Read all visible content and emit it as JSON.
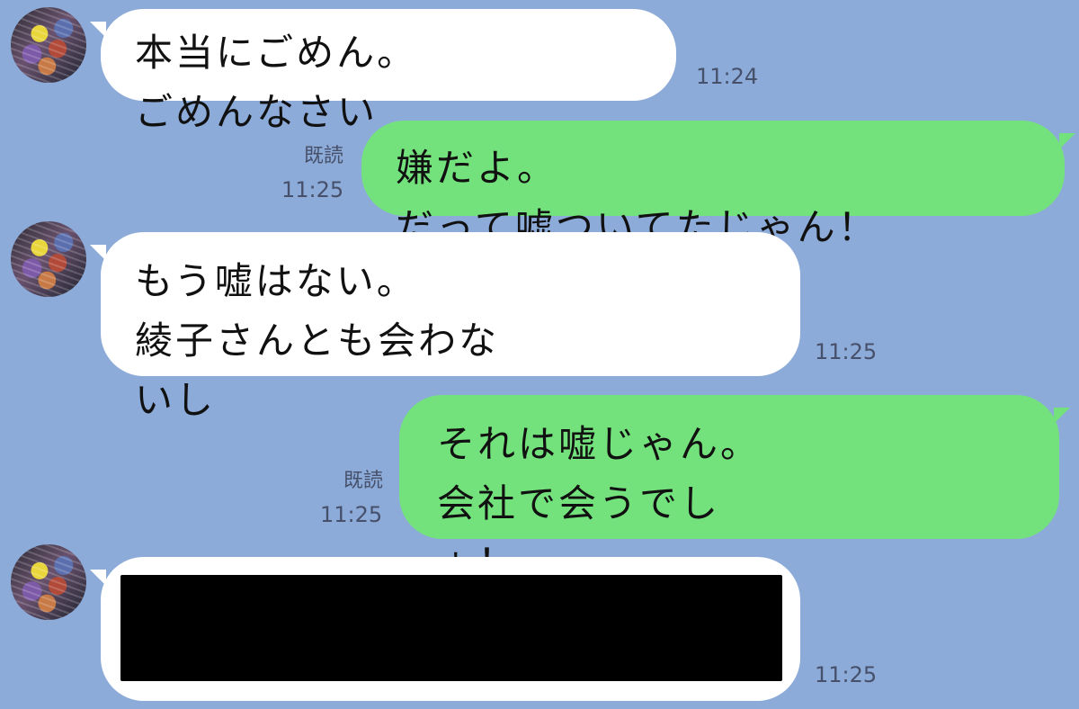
{
  "chat": {
    "messages": [
      {
        "id": "m1",
        "side": "received",
        "text": "本当にごめん。ごめんなさい",
        "time": "11:24"
      },
      {
        "id": "m2",
        "side": "sent",
        "read": "既読",
        "time": "11:25",
        "text": "嫌だよ。だって嘘ついてたじゃん！"
      },
      {
        "id": "m3",
        "side": "received",
        "text": "もう嘘はない。綾子さんとも会わな\nいし",
        "time": "11:25"
      },
      {
        "id": "m4",
        "side": "sent",
        "read": "既読",
        "time": "11:25",
        "text": "それは嘘じゃん。会社で会うでし\nょ！"
      },
      {
        "id": "m5",
        "side": "received",
        "text": "",
        "time": "11:25",
        "redacted": true
      }
    ]
  },
  "colors": {
    "background": "#8cabd9",
    "received_bubble": "#ffffff",
    "sent_bubble": "#74e27c",
    "meta_text": "#47506a",
    "redaction": "#000000"
  },
  "icons": {
    "avatar": "user-avatar-image"
  }
}
